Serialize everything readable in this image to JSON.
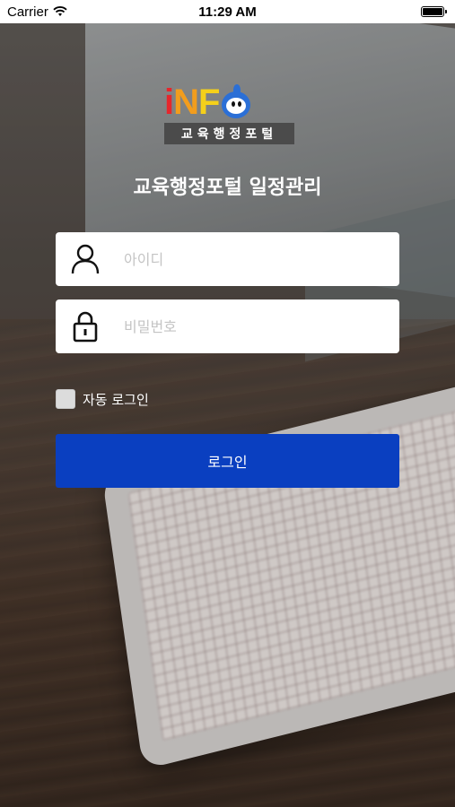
{
  "status_bar": {
    "carrier": "Carrier",
    "time": "11:29 AM",
    "wifi_icon": "wifi-icon",
    "battery_icon": "battery-icon"
  },
  "logo": {
    "letter_i": "i",
    "letter_n": "N",
    "letter_f": "F",
    "mascot_icon": "mascot-o-icon",
    "subtitle": "교육행정포털",
    "colors": {
      "i": "#e6262c",
      "n": "#f29d1d",
      "f": "#f5d01a",
      "mascot": "#2b6fd6"
    }
  },
  "title": "교육행정포털 일정관리",
  "login_form": {
    "id_field": {
      "placeholder": "아이디",
      "value": "",
      "icon": "user-icon"
    },
    "password_field": {
      "placeholder": "비밀번호",
      "value": "",
      "icon": "lock-icon"
    },
    "auto_login": {
      "label": "자동 로그인",
      "checked": false
    },
    "submit_label": "로그인"
  },
  "colors": {
    "button": "#0a3fc0",
    "text_on_dark": "#ffffff"
  }
}
